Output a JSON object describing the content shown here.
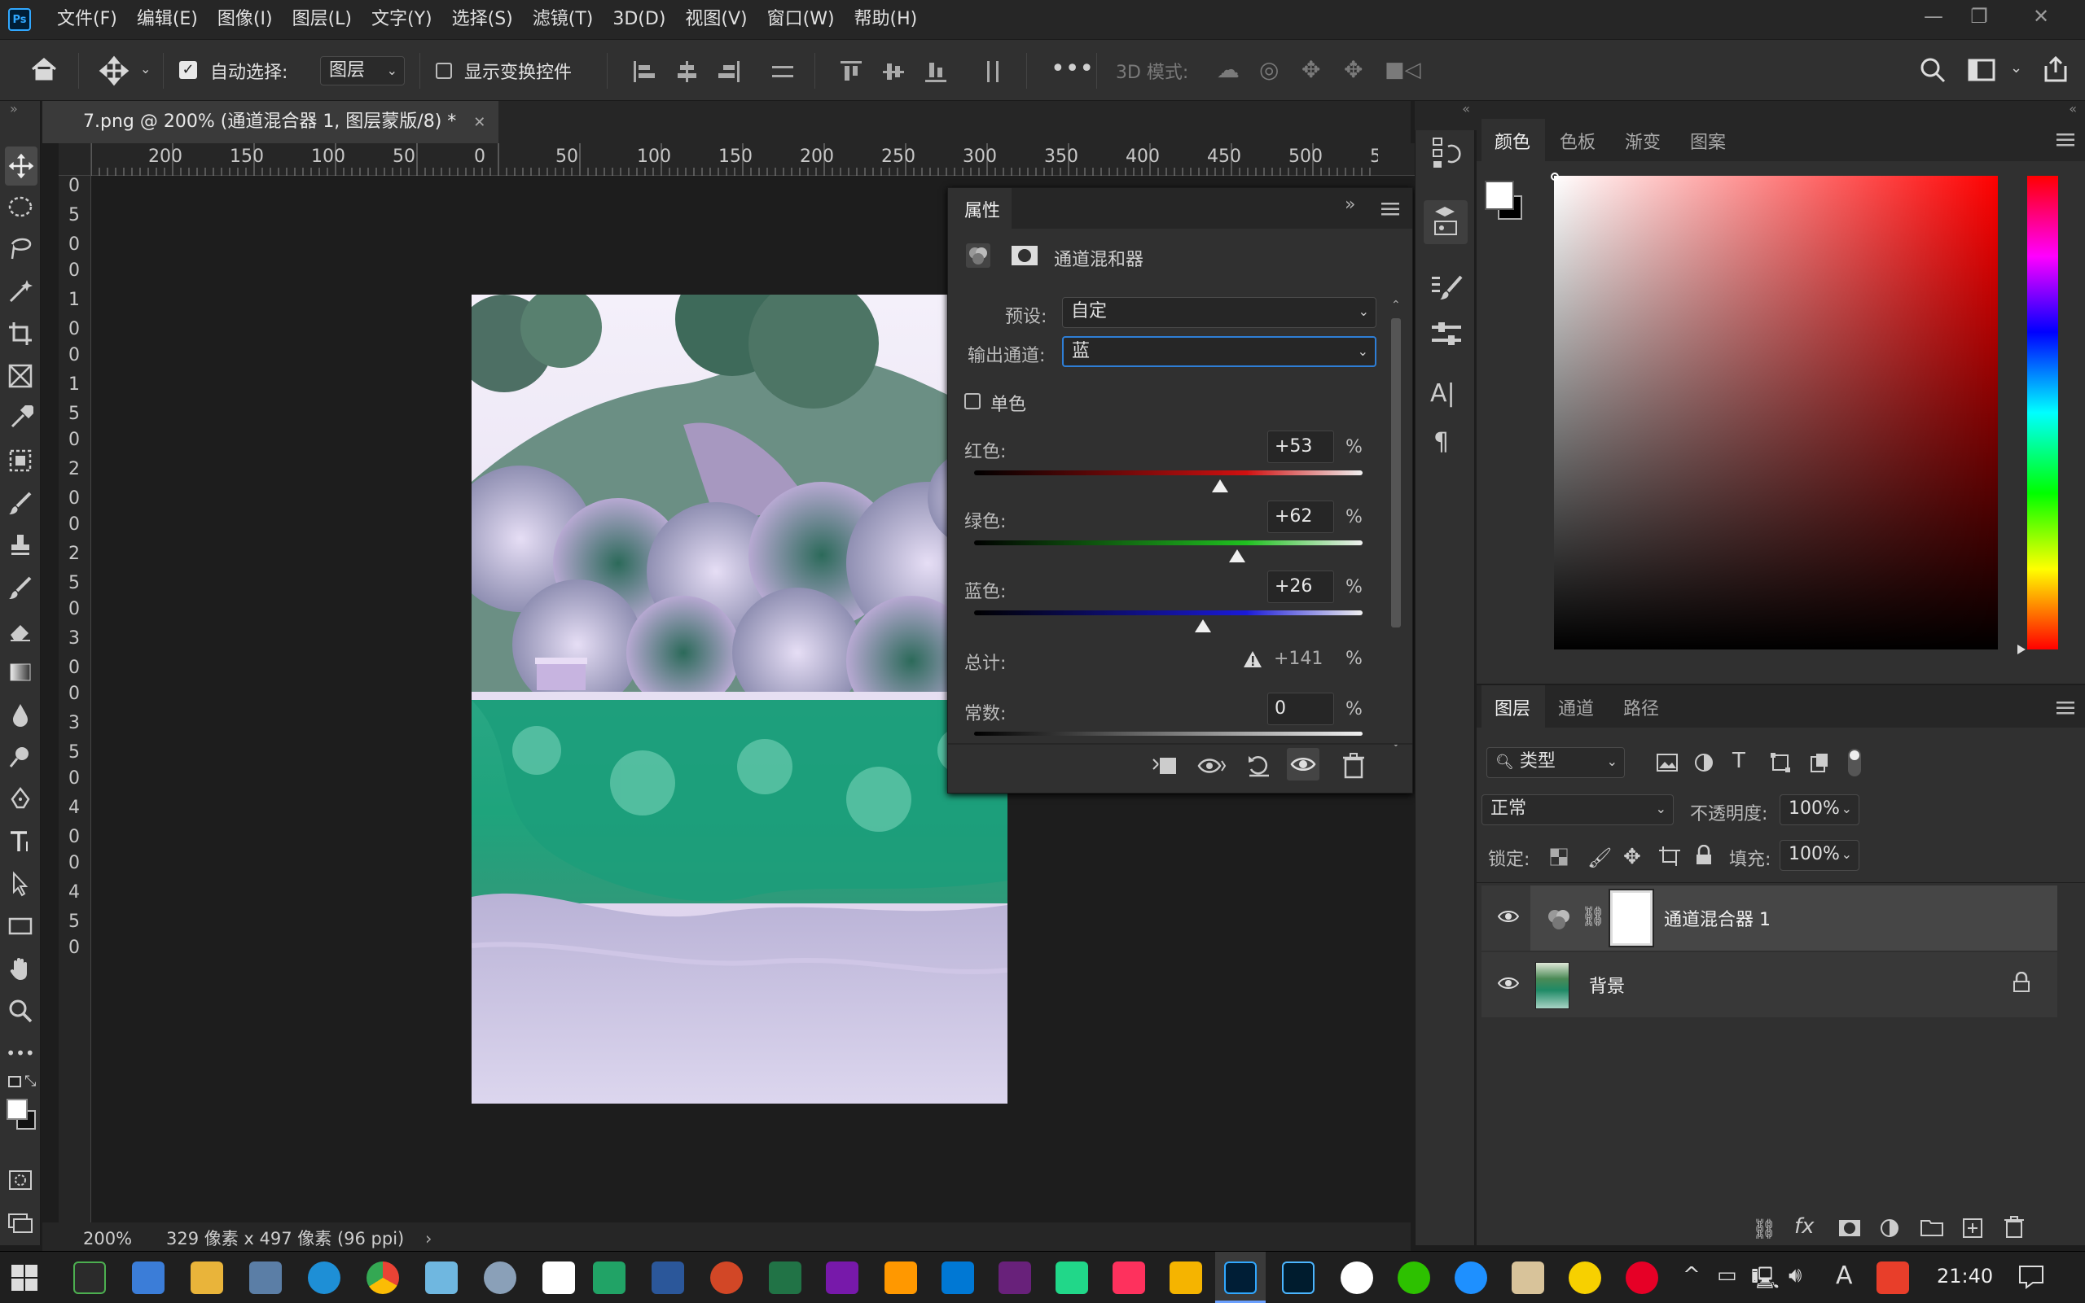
{
  "app": {
    "logo": "Ps"
  },
  "menu": [
    "文件(F)",
    "编辑(E)",
    "图像(I)",
    "图层(L)",
    "文字(Y)",
    "选择(S)",
    "滤镜(T)",
    "3D(D)",
    "视图(V)",
    "窗口(W)",
    "帮助(H)"
  ],
  "options": {
    "auto_select_label": "自动选择:",
    "auto_select_value": "图层",
    "show_transform_label": "显示变换控件",
    "mode3d_label": "3D 模式:"
  },
  "document": {
    "tab_title": "7.png @ 200% (通道混合器 1, 图层蒙版/8) *",
    "zoom": "200%",
    "doc_info": "329 像素 x 497 像素 (96 ppi)",
    "ruler_top": [
      "200",
      "150",
      "100",
      "50",
      "0",
      "50",
      "100",
      "150",
      "200",
      "250",
      "300",
      "350",
      "400",
      "450",
      "500",
      "5"
    ],
    "ruler_left": [
      "0",
      "5",
      "0",
      "0",
      "1",
      "0",
      "0",
      "1",
      "5",
      "0",
      "2",
      "0",
      "0",
      "2",
      "5",
      "0",
      "3",
      "0",
      "0",
      "3",
      "5",
      "0",
      "4",
      "0",
      "0",
      "4",
      "5",
      "0"
    ]
  },
  "properties": {
    "title": "属性",
    "adjustment_name": "通道混和器",
    "preset_label": "预设:",
    "preset_value": "自定",
    "output_label": "输出通道:",
    "output_value": "蓝",
    "mono_label": "单色",
    "red_label": "红色:",
    "red_value": "+53",
    "green_label": "绿色:",
    "green_value": "+62",
    "blue_label": "蓝色:",
    "blue_value": "+26",
    "total_label": "总计:",
    "total_value": "+141",
    "constant_label": "常数:",
    "constant_value": "0",
    "percent": "%"
  },
  "color_panel": {
    "tabs": [
      "颜色",
      "色板",
      "渐变",
      "图案"
    ]
  },
  "layers_panel": {
    "tabs": [
      "图层",
      "通道",
      "路径"
    ],
    "filter_label": "类型",
    "blend_mode": "正常",
    "opacity_label": "不透明度:",
    "opacity_value": "100%",
    "lock_label": "锁定:",
    "fill_label": "填充:",
    "fill_value": "100%",
    "layers": [
      {
        "name": "通道混合器 1"
      },
      {
        "name": "背景"
      }
    ]
  },
  "taskbar": {
    "time": "21:40",
    "ime": "A"
  }
}
